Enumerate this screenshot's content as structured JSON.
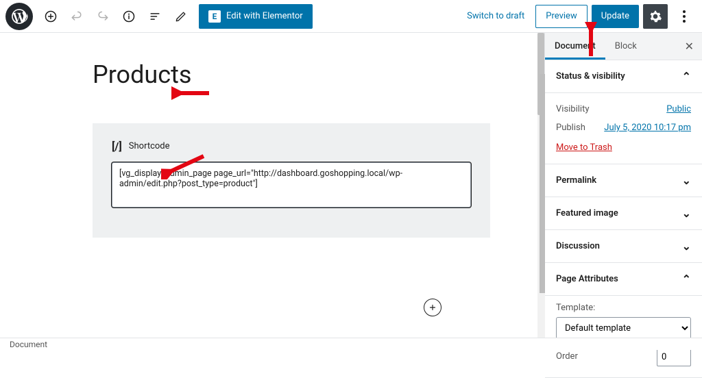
{
  "topbar": {
    "elementor_label": "Edit with Elementor",
    "switch_draft": "Switch to draft",
    "preview": "Preview",
    "update": "Update"
  },
  "editor": {
    "page_title": "Products",
    "shortcode_label": "Shortcode",
    "shortcode_value": "[vg_display_admin_page page_url=\"http://dashboard.goshopping.local/wp-admin/edit.php?post_type=product\"]"
  },
  "sidebar": {
    "tabs": {
      "document": "Document",
      "block": "Block"
    },
    "close_glyph": "✕",
    "status_head": "Status & visibility",
    "visibility_label": "Visibility",
    "visibility_value": "Public",
    "publish_label": "Publish",
    "publish_value": "July 5, 2020 10:17 pm",
    "trash": "Move to Trash",
    "permalink": "Permalink",
    "featured_image": "Featured image",
    "discussion": "Discussion",
    "page_attributes": "Page Attributes",
    "template_label": "Template:",
    "template_value": "Default template",
    "order_label": "Order",
    "order_value": "0"
  },
  "footer": {
    "breadcrumb": "Document"
  }
}
